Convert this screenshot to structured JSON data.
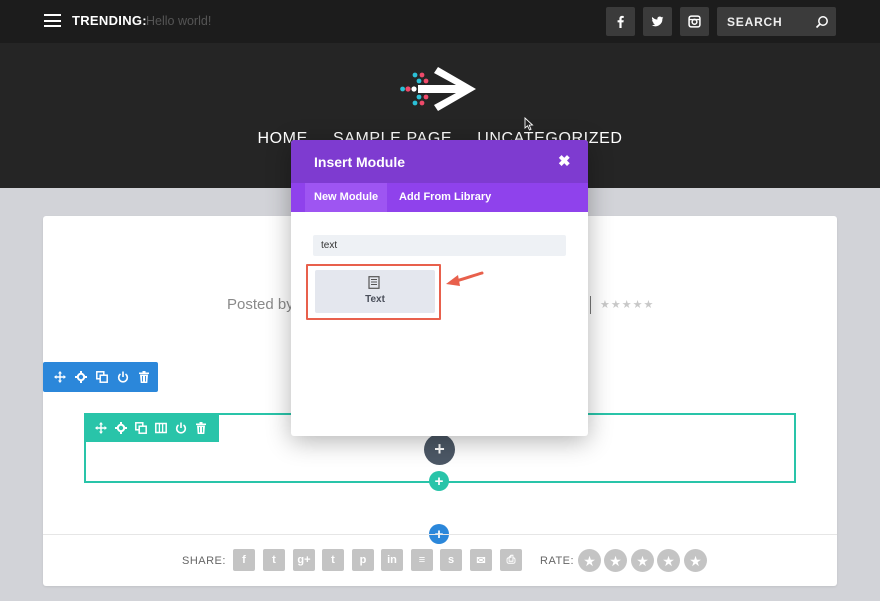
{
  "topbar": {
    "trending_label": "TRENDING:",
    "trending_text": "Hello world!",
    "social_icons": [
      "facebook-icon",
      "twitter-icon",
      "instagram-icon"
    ],
    "search_placeholder": "SEARCH"
  },
  "nav": {
    "items": [
      "HOME",
      "SAMPLE PAGE",
      "UNCATEGORIZED"
    ]
  },
  "post": {
    "posted_by": "Posted by"
  },
  "modal": {
    "title": "Insert Module",
    "close": "✖",
    "tabs": [
      "New Module",
      "Add From Library"
    ],
    "active_tab": "New Module",
    "search_value": "text",
    "result_module": "Text"
  },
  "share": {
    "label": "SHARE:",
    "icons": [
      "facebook",
      "twitter",
      "google-plus",
      "tumblr",
      "pinterest",
      "linkedin",
      "buffer",
      "stumbleupon",
      "email",
      "print"
    ],
    "glyphs": [
      "f",
      "t",
      "g+",
      "t",
      "p",
      "in",
      "≡",
      "s",
      "✉",
      "⎙"
    ]
  },
  "rating": {
    "label": "RATE:",
    "stars": 5
  },
  "colors": {
    "topbar": "#1c1c1c",
    "header": "#252525",
    "modal_header": "#7e3bd0",
    "modal_tabs": "#8f42ec",
    "section_blue": "#2b87da",
    "row_teal": "#29c4a9",
    "module_dark": "#4c5866",
    "highlight": "#e8604c"
  }
}
